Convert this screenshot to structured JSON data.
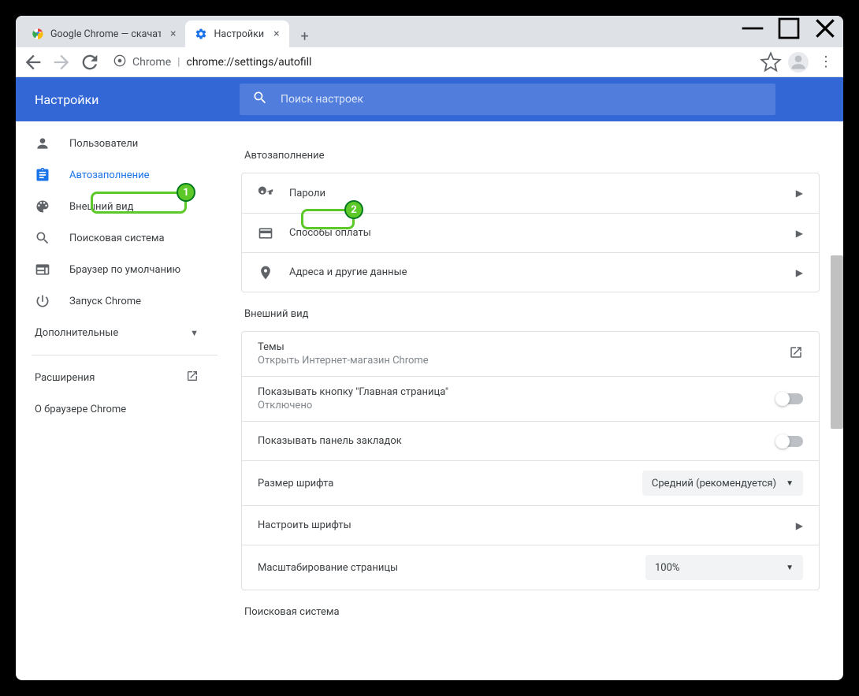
{
  "window": {
    "tabs": [
      {
        "title": "Google Chrome — скачать бесп",
        "active": false
      },
      {
        "title": "Настройки",
        "active": true
      }
    ]
  },
  "omnibox": {
    "scheme_label": "Chrome",
    "url": "chrome://settings/autofill"
  },
  "header": {
    "title": "Настройки",
    "search_placeholder": "Поиск настроек"
  },
  "sidebar": {
    "items": [
      {
        "label": "Пользователи",
        "icon": "person"
      },
      {
        "label": "Автозаполнение",
        "icon": "assignment",
        "selected": true
      },
      {
        "label": "Внешний вид",
        "icon": "palette"
      },
      {
        "label": "Поисковая система",
        "icon": "search"
      },
      {
        "label": "Браузер по умолчанию",
        "icon": "web"
      },
      {
        "label": "Запуск Chrome",
        "icon": "power"
      }
    ],
    "advanced": "Дополнительные",
    "extensions": "Расширения",
    "about": "О браузере Chrome"
  },
  "sections": {
    "autofill": {
      "title": "Автозаполнение",
      "rows": [
        {
          "label": "Пароли"
        },
        {
          "label": "Способы оплаты"
        },
        {
          "label": "Адреса и другие данные"
        }
      ]
    },
    "appearance": {
      "title": "Внешний вид",
      "themes": {
        "label": "Темы",
        "sub": "Открыть Интернет-магазин Chrome"
      },
      "homebutton": {
        "label": "Показывать кнопку \"Главная страница\"",
        "sub": "Отключено"
      },
      "bookmarks": {
        "label": "Показывать панель закладок"
      },
      "fontsize": {
        "label": "Размер шрифта",
        "value": "Средний (рекомендуется)"
      },
      "customfonts": {
        "label": "Настроить шрифты"
      },
      "zoom": {
        "label": "Масштабирование страницы",
        "value": "100%"
      }
    },
    "search": {
      "title": "Поисковая система"
    }
  },
  "callouts": {
    "one": "1",
    "two": "2"
  }
}
